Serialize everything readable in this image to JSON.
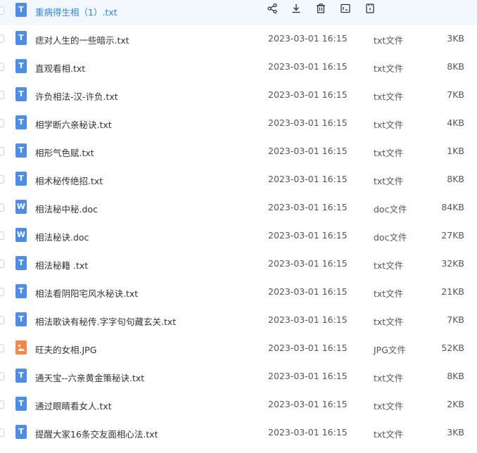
{
  "selected_row": {
    "name": "重病得生相（1）.txt",
    "icon": "txt-file-icon",
    "icon_letter": "T",
    "actions": [
      {
        "name": "share-icon"
      },
      {
        "name": "download-icon"
      },
      {
        "name": "delete-icon"
      },
      {
        "name": "rename-icon"
      },
      {
        "name": "more-icon"
      }
    ]
  },
  "files": [
    {
      "name": "痣对人生的一些暗示.txt",
      "date": "2023-03-01 16:15",
      "type": "txt文件",
      "size": "3KB",
      "icon": "txt",
      "icon_letter": "T"
    },
    {
      "name": "直观看相.txt",
      "date": "2023-03-01 16:15",
      "type": "txt文件",
      "size": "8KB",
      "icon": "txt",
      "icon_letter": "T"
    },
    {
      "name": "许负相法-汉-许负.txt",
      "date": "2023-03-01 16:15",
      "type": "txt文件",
      "size": "7KB",
      "icon": "txt",
      "icon_letter": "T"
    },
    {
      "name": "相学断六亲秘诀.txt",
      "date": "2023-03-01 16:15",
      "type": "txt文件",
      "size": "4KB",
      "icon": "txt",
      "icon_letter": "T"
    },
    {
      "name": "相形气色赋.txt",
      "date": "2023-03-01 16:15",
      "type": "txt文件",
      "size": "1KB",
      "icon": "txt",
      "icon_letter": "T"
    },
    {
      "name": "相术秘传绝招.txt",
      "date": "2023-03-01 16:15",
      "type": "txt文件",
      "size": "8KB",
      "icon": "txt",
      "icon_letter": "T"
    },
    {
      "name": "相法秘中秘.doc",
      "date": "2023-03-01 16:15",
      "type": "doc文件",
      "size": "84KB",
      "icon": "doc",
      "icon_letter": "W"
    },
    {
      "name": "相法秘诀.doc",
      "date": "2023-03-01 16:15",
      "type": "doc文件",
      "size": "27KB",
      "icon": "doc",
      "icon_letter": "W"
    },
    {
      "name": "相法秘籍 .txt",
      "date": "2023-03-01 16:15",
      "type": "txt文件",
      "size": "32KB",
      "icon": "txt",
      "icon_letter": "T"
    },
    {
      "name": "相法看阴阳宅风水秘诀.txt",
      "date": "2023-03-01 16:15",
      "type": "txt文件",
      "size": "21KB",
      "icon": "txt",
      "icon_letter": "T"
    },
    {
      "name": "相法歌诀有秘传.字字句句藏玄关.txt",
      "date": "2023-03-01 16:15",
      "type": "txt文件",
      "size": "7KB",
      "icon": "txt",
      "icon_letter": "T"
    },
    {
      "name": "旺夫的女相.JPG",
      "date": "2023-03-01 16:15",
      "type": "JPG文件",
      "size": "52KB",
      "icon": "img",
      "icon_letter": ""
    },
    {
      "name": "通天宝--六亲黄金策秘诀.txt",
      "date": "2023-03-01 16:15",
      "type": "txt文件",
      "size": "8KB",
      "icon": "txt",
      "icon_letter": "T"
    },
    {
      "name": "通过眼睛看女人.txt",
      "date": "2023-03-01 16:15",
      "type": "txt文件",
      "size": "2KB",
      "icon": "txt",
      "icon_letter": "T"
    },
    {
      "name": "提醒大家16条交友面相心法.txt",
      "date": "2023-03-01 16:15",
      "type": "txt文件",
      "size": "3KB",
      "icon": "txt",
      "icon_letter": "T"
    }
  ],
  "colors": {
    "selected_bg": "#f3f8fe",
    "selected_text": "#2c84e8",
    "txt_icon": "#4d8dea",
    "doc_icon": "#4d8dea",
    "img_icon": "#f2884b"
  }
}
